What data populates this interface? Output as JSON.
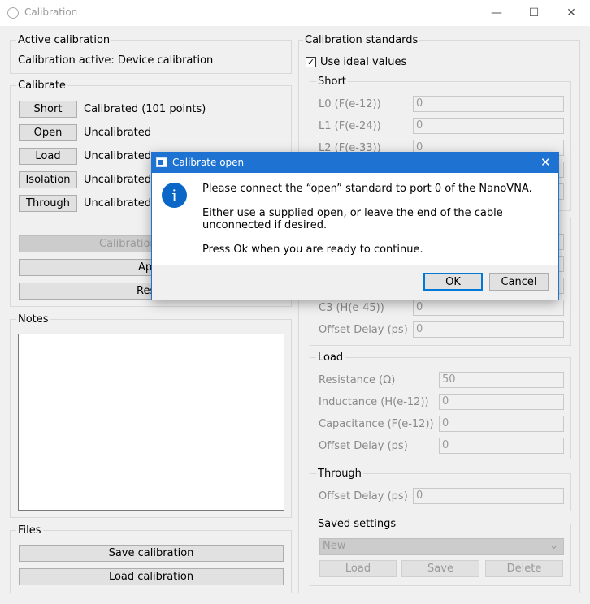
{
  "window": {
    "title": "Calibration",
    "minimize": "—",
    "maximize": "☐",
    "close": "✕"
  },
  "active_calibration": {
    "label": "Active calibration",
    "status": "Calibration active: Device calibration"
  },
  "calibrate": {
    "label": "Calibrate",
    "rows": [
      {
        "button": "Short",
        "status": "Calibrated (101 points)"
      },
      {
        "button": "Open",
        "status": "Uncalibrated"
      },
      {
        "button": "Load",
        "status": "Uncalibrated"
      },
      {
        "button": "Isolation",
        "status": "Uncalibrated"
      },
      {
        "button": "Through",
        "status": "Uncalibrated"
      }
    ],
    "calibration_assistant_partial": "Calibration",
    "apply_partial": "Ap",
    "reset_partial": "Res"
  },
  "notes": {
    "label": "Notes",
    "value": ""
  },
  "files": {
    "label": "Files",
    "save": "Save calibration",
    "load": "Load calibration"
  },
  "standards": {
    "label": "Calibration standards",
    "use_ideal": {
      "label": "Use ideal values",
      "checked": true
    },
    "short": {
      "label": "Short",
      "fields": [
        {
          "label": "L0 (F(e-12))",
          "value": "0"
        },
        {
          "label": "L1 (F(e-24))",
          "value": "0"
        },
        {
          "label": "L2 (F(e-33))",
          "value": "0"
        }
      ]
    },
    "open": {
      "c3_label": "C3 (H(e-45))",
      "c3_value": "0",
      "offset_label": "Offset Delay (ps)",
      "offset_value": "0"
    },
    "load": {
      "label": "Load",
      "fields": [
        {
          "label": "Resistance (Ω)",
          "value": "50"
        },
        {
          "label": "Inductance (H(e-12))",
          "value": "0"
        },
        {
          "label": "Capacitance (F(e-12))",
          "value": "0"
        },
        {
          "label": "Offset Delay (ps)",
          "value": "0"
        }
      ]
    },
    "through": {
      "label": "Through",
      "offset_label": "Offset Delay (ps)",
      "offset_value": "0"
    },
    "saved": {
      "label": "Saved settings",
      "selected": "New",
      "load": "Load",
      "save": "Save",
      "delete": "Delete"
    }
  },
  "dialog": {
    "title": "Calibrate open",
    "line1": "Please connect the “open” standard to port 0 of the NanoVNA.",
    "line2a": "Either use a supplied open, or leave the end of the cable",
    "line2b": "unconnected if desired.",
    "line3": "Press Ok when you are ready to continue.",
    "ok": "OK",
    "cancel": "Cancel",
    "icon": "info-icon"
  }
}
